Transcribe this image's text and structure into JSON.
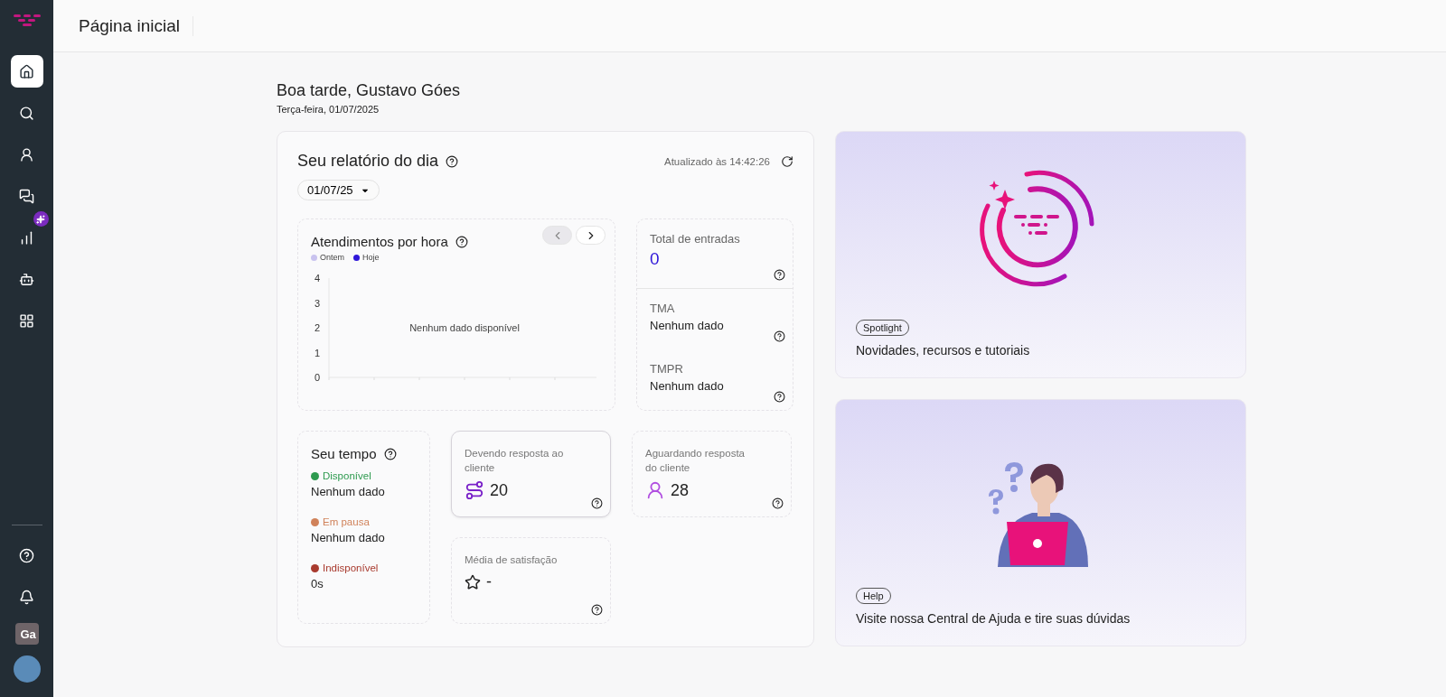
{
  "header": {
    "title": "Página inicial"
  },
  "sidebar": {
    "items": [
      {
        "kind": "home",
        "selected": true,
        "badge": false
      },
      {
        "kind": "search",
        "selected": false,
        "badge": false
      },
      {
        "kind": "contacts",
        "selected": false,
        "badge": false
      },
      {
        "kind": "chats",
        "selected": false,
        "badge": false
      },
      {
        "kind": "reports",
        "selected": false,
        "badge": true
      },
      {
        "kind": "bot",
        "selected": false,
        "badge": false
      },
      {
        "kind": "apps",
        "selected": false,
        "badge": false
      }
    ],
    "bottom": [
      {
        "kind": "help"
      },
      {
        "kind": "notifications"
      },
      {
        "kind": "initials",
        "text": "Ga"
      },
      {
        "kind": "avatar"
      }
    ]
  },
  "greeting": {
    "title": "Boa tarde, Gustavo Góes",
    "date": "Terça-feira, 01/07/2025"
  },
  "report": {
    "title": "Seu relatório do dia",
    "updated": "Atualizado às 14:42:26",
    "date_filter": "01/07/25",
    "hourly": {
      "title": "Atendimentos por hora",
      "prev_disabled": true,
      "chart_data": {
        "type": "line",
        "ylim": [
          0,
          4
        ],
        "yticks": [
          0,
          1,
          2,
          3,
          4
        ],
        "annotations": [
          "Nenhum dado disponível"
        ],
        "series": [
          {
            "name": "Ontem",
            "color": "#c9c3ef"
          },
          {
            "name": "Hoje",
            "color": "#2f17d9"
          }
        ]
      }
    },
    "stats": [
      {
        "label": "Total de entradas",
        "value": "0",
        "kind": "number"
      },
      {
        "label": "TMA",
        "value": "Nenhum dado",
        "kind": "text"
      },
      {
        "label": "TMPR",
        "value": "Nenhum dado",
        "kind": "text"
      }
    ],
    "time": {
      "title": "Seu tempo",
      "statuses": [
        {
          "label": "Disponível",
          "value": "Nenhum dado",
          "color": "#2e9a4f"
        },
        {
          "label": "Em pausa",
          "value": "Nenhum dado",
          "color": "#d0825a"
        },
        {
          "label": "Indisponível",
          "value": "0s",
          "color": "#a83a2e"
        }
      ]
    },
    "metrics": [
      {
        "label": "Devendo resposta ao cliente",
        "value": "20",
        "kind": "owing",
        "highlighted": true
      },
      {
        "label": "Aguardando resposta do cliente",
        "value": "28",
        "kind": "waiting",
        "highlighted": false
      },
      {
        "label": "Média de satisfação",
        "value": "-",
        "kind": "rating",
        "highlighted": false
      }
    ]
  },
  "promos": [
    {
      "kind": "spotlight",
      "tag": "Spotlight",
      "text": "Novidades, recursos e tutoriais"
    },
    {
      "kind": "help",
      "tag": "Help",
      "text": "Visite nossa Central de Ajuda e tire suas dúvidas"
    }
  ]
}
